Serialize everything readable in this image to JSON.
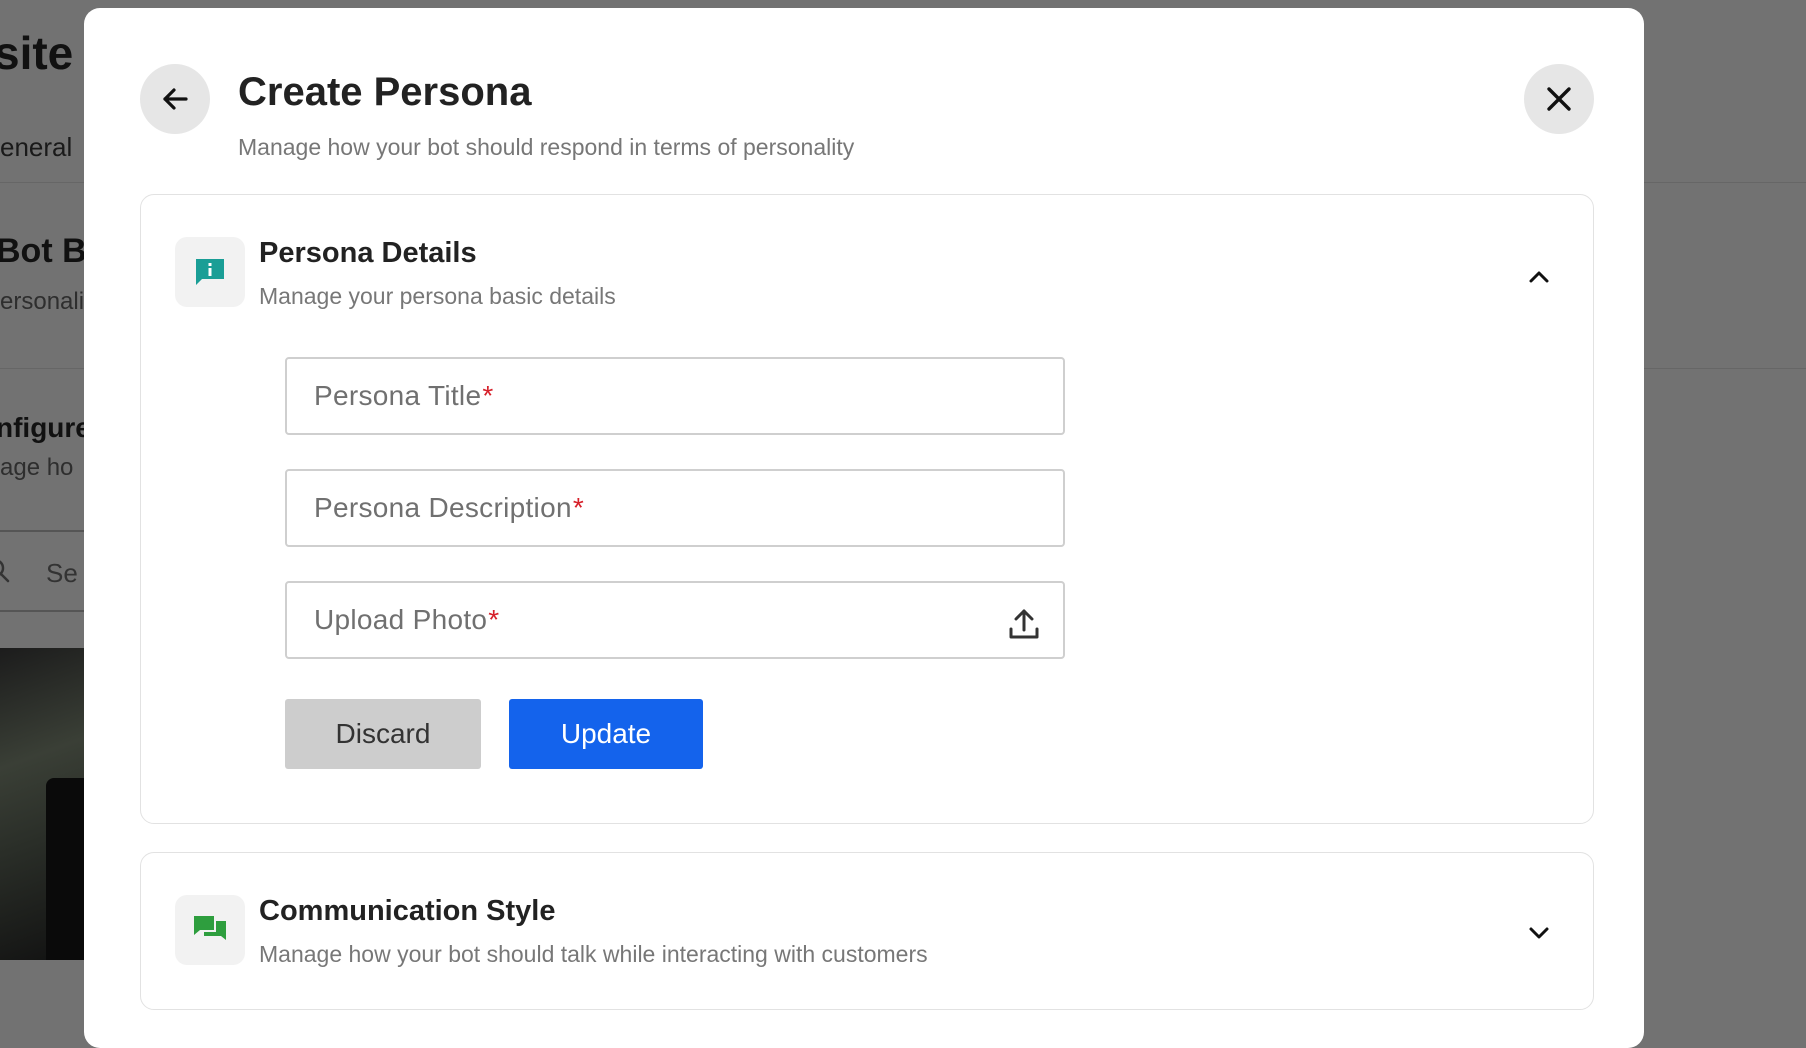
{
  "background": {
    "title": "site",
    "tab": "eneral",
    "heading": "Bot B",
    "subheading": "ersonali",
    "config_heading": "nfigure",
    "config_sub": "age ho",
    "search_text": "Se"
  },
  "modal": {
    "title": "Create Persona",
    "subtitle": "Manage how your bot should respond in terms of personality",
    "back_icon": "arrow-left-icon",
    "close_icon": "close-icon"
  },
  "persona_details": {
    "title": "Persona Details",
    "subtitle": "Manage your persona basic details",
    "icon": "info-chat-icon",
    "icon_color": "#1a9e96",
    "expanded": true,
    "fields": {
      "title_placeholder": "Persona Title",
      "description_placeholder": "Persona Description",
      "upload_label": "Upload Photo",
      "required_mark": "*"
    },
    "buttons": {
      "discard": "Discard",
      "update": "Update"
    }
  },
  "communication_style": {
    "title": "Communication Style",
    "subtitle": "Manage how your bot should talk while interacting with customers",
    "icon": "chat-bubbles-icon",
    "icon_color": "#2e9e3e",
    "expanded": false
  },
  "colors": {
    "primary": "#1463ec",
    "required": "#d6202a",
    "overlay": "#727272"
  }
}
